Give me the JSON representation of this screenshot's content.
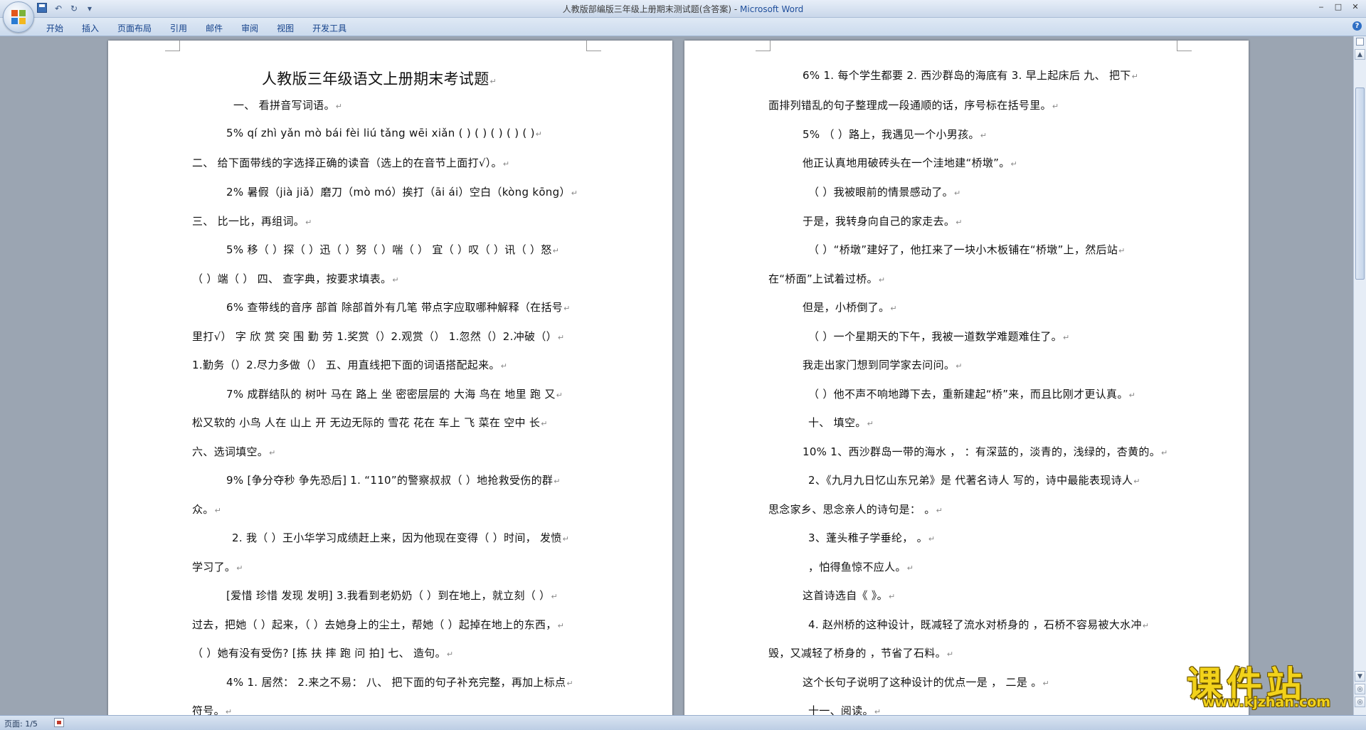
{
  "window": {
    "title_doc": "人教版部编版三年级上册期末测试题(含答案)",
    "title_sep": " - ",
    "title_app": "Microsoft Word",
    "minimize": "‒",
    "maximize": "□",
    "close": "✕"
  },
  "qat": {
    "undo": "↶",
    "redo": "↻",
    "customize": "▾"
  },
  "ribbon": {
    "tabs": [
      "开始",
      "插入",
      "页面布局",
      "引用",
      "邮件",
      "审阅",
      "视图",
      "开发工具"
    ],
    "help": "?"
  },
  "page_left": {
    "lines": [
      "人教版三年级语文上册期末考试题",
      "一、 看拼音写词语。",
      "5% qí zhì yǎn mò bái fèi liú tǎng wēi xiǎn ( ) ( ) ( ) ( ) ( )",
      "二、 给下面带线的字选择正确的读音（选上的在音节上面打√）。",
      "2% 暑假（jià jiǎ）磨刀（mò mó）挨打（āi ái）空白（kòng kōng）",
      "三、 比一比，再组词。",
      "5% 移（ ）探（ ）迅（ ）努（ ）喘（ ） 宜（ ）叹（ ）讯（ ）怒",
      "（ ）端（ ） 四、 查字典，按要求填表。",
      "6% 查带线的音序 部首 除部首外有几笔 带点字应取哪种解释（在括号",
      "里打√） 字 欣 赏 突 围 勤 劳 1.奖赏（）2.观赏（） 1.忽然（）2.冲破（）",
      "1.勤务（）2.尽力多做（） 五、用直线把下面的词语搭配起来。",
      "7% 成群结队的 树叶 马在 路上 坐 密密层层的 大海 鸟在 地里 跑 又",
      "松又软的 小鸟 人在 山上 开 无边无际的 雪花 花在 车上 飞 菜在 空中 长",
      "六、选词填空。",
      "9% [争分夺秒 争先恐后] 1. “110”的警察叔叔（ ）地抢救受伤的群",
      "众。",
      "2. 我（ ）王小华学习成绩赶上来，因为他现在变得（ ）时间， 发愤",
      "学习了。",
      "[爱惜 珍惜 发现 发明] 3.我看到老奶奶（ ）到在地上，就立刻（ ）",
      "过去，把她（ ）起来，（ ）去她身上的尘土，帮她（ ）起掉在地上的东西，",
      "（ ）她有没有受伤? [拣 扶 摔 跑 问 拍] 七、 造句。",
      "4% 1. 居然： 2.来之不易： 八、 把下面的句子补充完整，再加上标点",
      "符号。"
    ]
  },
  "page_right": {
    "lines": [
      "6% 1. 每个学生都要 2. 西沙群岛的海底有 3. 早上起床后 九、 把下",
      "面排列错乱的句子整理成一段通顺的话，序号标在括号里。",
      "5% （ ）路上，我遇见一个小男孩。",
      "他正认真地用破砖头在一个洼地建“桥墩”。",
      "（ ）我被眼前的情景感动了。",
      "于是，我转身向自己的家走去。",
      "（ ）“桥墩”建好了，他扛来了一块小木板铺在“桥墩”上，然后站",
      "在“桥面”上试着过桥。",
      "但是，小桥倒了。",
      "（ ）一个星期天的下午，我被一道数学难题难住了。",
      "我走出家门想到同学家去问问。",
      "（ ）他不声不响地蹲下去，重新建起“桥”来，而且比刚才更认真。",
      "十、 填空。",
      "10% 1、西沙群岛一带的海水 ， ：有深蓝的，淡青的，浅绿的，杏黄的。",
      "2、《九月九日忆山东兄弟》是 代著名诗人 写的，诗中最能表现诗人",
      "思念家乡、思念亲人的诗句是： 。",
      "3、蓬头稚子学垂纶， 。",
      "，怕得鱼惊不应人。",
      "这首诗选自《 》。",
      "4. 赵州桥的这种设计，既减轻了流水对桥身的 ，石桥不容易被大水冲",
      "毁，又减轻了桥身的 ，节省了石料。",
      "这个长句子说明了这种设计的优点一是 ， 二是 。",
      "十一、阅读。"
    ]
  },
  "paragraph_mark": "↵",
  "scrollbar": {
    "up": "▲",
    "down": "▼",
    "prev": "◎",
    "next": "◎"
  },
  "status": {
    "page": "页面: 1/5"
  },
  "watermark": {
    "main": "课件站",
    "url": "www.kjzhan.com"
  }
}
